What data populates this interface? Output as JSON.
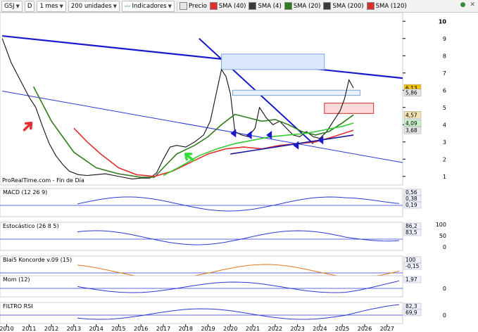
{
  "toolbar": {
    "symbol": "GSJ",
    "d_button": "D",
    "period": "1 mes",
    "units": "200 unidades",
    "indicators": "Indicadores",
    "legend": [
      {
        "label": "Precio",
        "color": "#e6e6e6"
      },
      {
        "label": "SMA (40)",
        "color": "#e03030"
      },
      {
        "label": "SMA (4)",
        "color": "#3a3a3a"
      },
      {
        "label": "SMA (20)",
        "color": "#2f7d1f"
      },
      {
        "label": "SMA (200)",
        "color": "#3a3a3a"
      },
      {
        "label": "SMA (120)",
        "color": "#d63030"
      }
    ]
  },
  "watermark": "ProRealTime.com - Fin de Día",
  "panels": {
    "macd": {
      "label": "MACD (12 26 9)",
      "tags": [
        "0,56",
        "0,38",
        "0,19"
      ]
    },
    "stoch": {
      "label": "Estocástico (26 8 5)",
      "tags": [
        "86,2",
        "83,5"
      ],
      "axis": [
        "100",
        "50",
        "0"
      ]
    },
    "koncorde": {
      "label": "Blai5 Koncorde v.09 (15)",
      "tags": [
        "100",
        "-0,15"
      ]
    },
    "mom": {
      "label": "Mom (12)",
      "tags": [
        "1,97"
      ],
      "axis": [
        "0"
      ]
    },
    "rsi": {
      "label": "FILTRO RSI",
      "tags": [
        "82,3",
        "69,9"
      ],
      "axis": [
        "0"
      ]
    }
  },
  "chart_data": {
    "type": "line",
    "title": "GSJ",
    "xlabel": "",
    "ylabel": "",
    "x_ticks": [
      "2010",
      "2011",
      "2012",
      "2013",
      "2014",
      "2015",
      "2016",
      "2017",
      "2018",
      "2019",
      "2020",
      "2021",
      "2022",
      "2023",
      "2024",
      "2025",
      "2026",
      "2027"
    ],
    "y_ticks": [
      1,
      2,
      3,
      4,
      5,
      6,
      7,
      8,
      9,
      10
    ],
    "ylim": [
      0.5,
      10.5
    ],
    "xlim": [
      2009.7,
      2027.7
    ],
    "price_tags": [
      "6,13",
      "5,86",
      "4,57",
      "4,09",
      "3,68"
    ],
    "series": [
      {
        "name": "Precio",
        "color": "#111111",
        "points": [
          [
            2009.8,
            9.0
          ],
          [
            2010.2,
            7.6
          ],
          [
            2010.6,
            6.6
          ],
          [
            2011.0,
            5.6
          ],
          [
            2011.3,
            5.0
          ],
          [
            2011.6,
            3.9
          ],
          [
            2011.9,
            2.9
          ],
          [
            2012.2,
            2.2
          ],
          [
            2012.5,
            1.7
          ],
          [
            2012.8,
            1.3
          ],
          [
            2013.2,
            1.1
          ],
          [
            2013.6,
            1.05
          ],
          [
            2014.0,
            1.1
          ],
          [
            2014.4,
            1.15
          ],
          [
            2014.8,
            1.05
          ],
          [
            2015.2,
            0.95
          ],
          [
            2015.6,
            0.85
          ],
          [
            2016.0,
            0.9
          ],
          [
            2016.4,
            0.9
          ],
          [
            2016.7,
            1.2
          ],
          [
            2017.0,
            2.0
          ],
          [
            2017.3,
            2.7
          ],
          [
            2017.6,
            2.8
          ],
          [
            2018.0,
            2.7
          ],
          [
            2018.4,
            3.0
          ],
          [
            2018.8,
            3.4
          ],
          [
            2019.1,
            4.2
          ],
          [
            2019.4,
            6.0
          ],
          [
            2019.6,
            7.2
          ],
          [
            2019.8,
            6.8
          ],
          [
            2020.0,
            5.8
          ],
          [
            2020.2,
            3.6
          ],
          [
            2020.5,
            3.4
          ],
          [
            2020.8,
            3.3
          ],
          [
            2021.1,
            3.8
          ],
          [
            2021.3,
            5.0
          ],
          [
            2021.6,
            4.4
          ],
          [
            2021.9,
            4.0
          ],
          [
            2022.2,
            4.2
          ],
          [
            2022.5,
            3.8
          ],
          [
            2022.8,
            3.4
          ],
          [
            2023.1,
            3.3
          ],
          [
            2023.4,
            3.6
          ],
          [
            2023.7,
            3.3
          ],
          [
            2024.0,
            3.2
          ],
          [
            2024.3,
            3.6
          ],
          [
            2024.6,
            4.2
          ],
          [
            2024.9,
            4.8
          ],
          [
            2025.1,
            5.5
          ],
          [
            2025.3,
            6.6
          ],
          [
            2025.5,
            6.13
          ]
        ]
      },
      {
        "name": "SMA (20)",
        "color": "#2f7d1f",
        "points": [
          [
            2011.2,
            6.2
          ],
          [
            2012.0,
            4.2
          ],
          [
            2013.0,
            2.4
          ],
          [
            2014.0,
            1.5
          ],
          [
            2015.0,
            1.15
          ],
          [
            2016.0,
            0.95
          ],
          [
            2016.6,
            0.95
          ],
          [
            2017.0,
            1.5
          ],
          [
            2017.6,
            2.3
          ],
          [
            2018.4,
            2.8
          ],
          [
            2019.0,
            3.3
          ],
          [
            2019.6,
            4.0
          ],
          [
            2020.2,
            4.6
          ],
          [
            2020.8,
            4.4
          ],
          [
            2021.4,
            4.2
          ],
          [
            2022.0,
            4.3
          ],
          [
            2022.6,
            4.0
          ],
          [
            2023.2,
            3.6
          ],
          [
            2023.8,
            3.4
          ],
          [
            2024.4,
            3.6
          ],
          [
            2025.0,
            4.1
          ],
          [
            2025.5,
            4.57
          ]
        ]
      },
      {
        "name": "SMA (40)",
        "color": "#e03030",
        "points": [
          [
            2013.0,
            3.8
          ],
          [
            2013.6,
            3.0
          ],
          [
            2014.2,
            2.3
          ],
          [
            2015.0,
            1.5
          ],
          [
            2015.8,
            1.1
          ],
          [
            2016.6,
            1.0
          ],
          [
            2017.4,
            1.3
          ],
          [
            2018.2,
            1.8
          ],
          [
            2019.0,
            2.3
          ],
          [
            2019.8,
            2.6
          ],
          [
            2020.6,
            2.7
          ],
          [
            2021.4,
            2.6
          ],
          [
            2022.2,
            2.8
          ],
          [
            2023.0,
            2.9
          ],
          [
            2023.8,
            3.0
          ],
          [
            2024.6,
            3.3
          ],
          [
            2025.5,
            3.68
          ]
        ]
      },
      {
        "name": "SMA (120)",
        "color": "#33cc33",
        "points": [
          [
            2017.0,
            1.05
          ],
          [
            2017.8,
            1.6
          ],
          [
            2018.6,
            2.2
          ],
          [
            2019.4,
            2.6
          ],
          [
            2020.2,
            2.9
          ],
          [
            2021.0,
            3.1
          ],
          [
            2021.8,
            3.3
          ],
          [
            2022.6,
            3.4
          ],
          [
            2023.4,
            3.5
          ],
          [
            2024.2,
            3.7
          ],
          [
            2025.0,
            3.9
          ],
          [
            2025.5,
            4.09
          ]
        ]
      },
      {
        "name": "SMA (200)",
        "color": "#1a1aa0",
        "points": [
          [
            2020.0,
            2.3
          ],
          [
            2021.0,
            2.5
          ],
          [
            2022.0,
            2.7
          ],
          [
            2023.0,
            2.9
          ],
          [
            2024.0,
            3.1
          ],
          [
            2025.0,
            3.3
          ],
          [
            2025.5,
            3.4
          ]
        ]
      }
    ]
  }
}
